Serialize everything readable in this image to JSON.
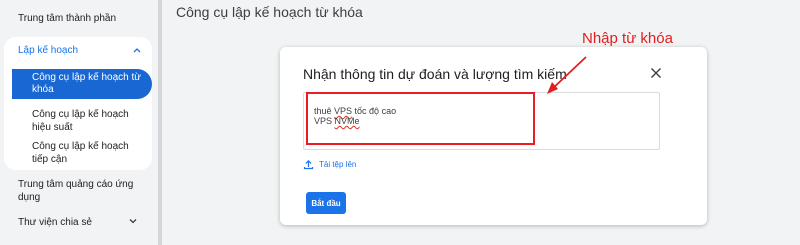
{
  "sidebar": {
    "top_item": "Trung tâm thành phần",
    "group": {
      "label": "Lập kế hoạch",
      "active_item": "Công cụ lập kế hoạch từ khóa",
      "items": [
        "Công cụ lập kế hoạch hiệu suất",
        "Công cụ lập kế hoạch tiếp cận"
      ]
    },
    "ads_center": "Trung tâm quảng cáo ứng dụng",
    "shared_library": "Thư viện chia sẻ"
  },
  "page": {
    "title": "Công cụ lập kế hoạch từ khóa"
  },
  "dialog": {
    "title": "Nhận thông tin dự đoán và lượng tìm kiếm",
    "keywords": {
      "line1_prefix": "thuê ",
      "line1_sq": "VPS",
      "line1_suffix": " tốc độ cao",
      "line2_prefix": "VPS ",
      "line2_sq": "NVMe"
    },
    "upload_label": "Tải tệp lên",
    "start_label": "Bắt đầu"
  },
  "annotation": {
    "label": "Nhập từ khóa"
  },
  "colors": {
    "accent": "#1a73e8",
    "active_nav": "#1967d2",
    "annotation": "#e02020"
  },
  "icons": {
    "close": "close-icon",
    "upload": "upload-icon",
    "chevron_up": "chevron-up-icon",
    "chevron_down": "chevron-down-icon"
  }
}
